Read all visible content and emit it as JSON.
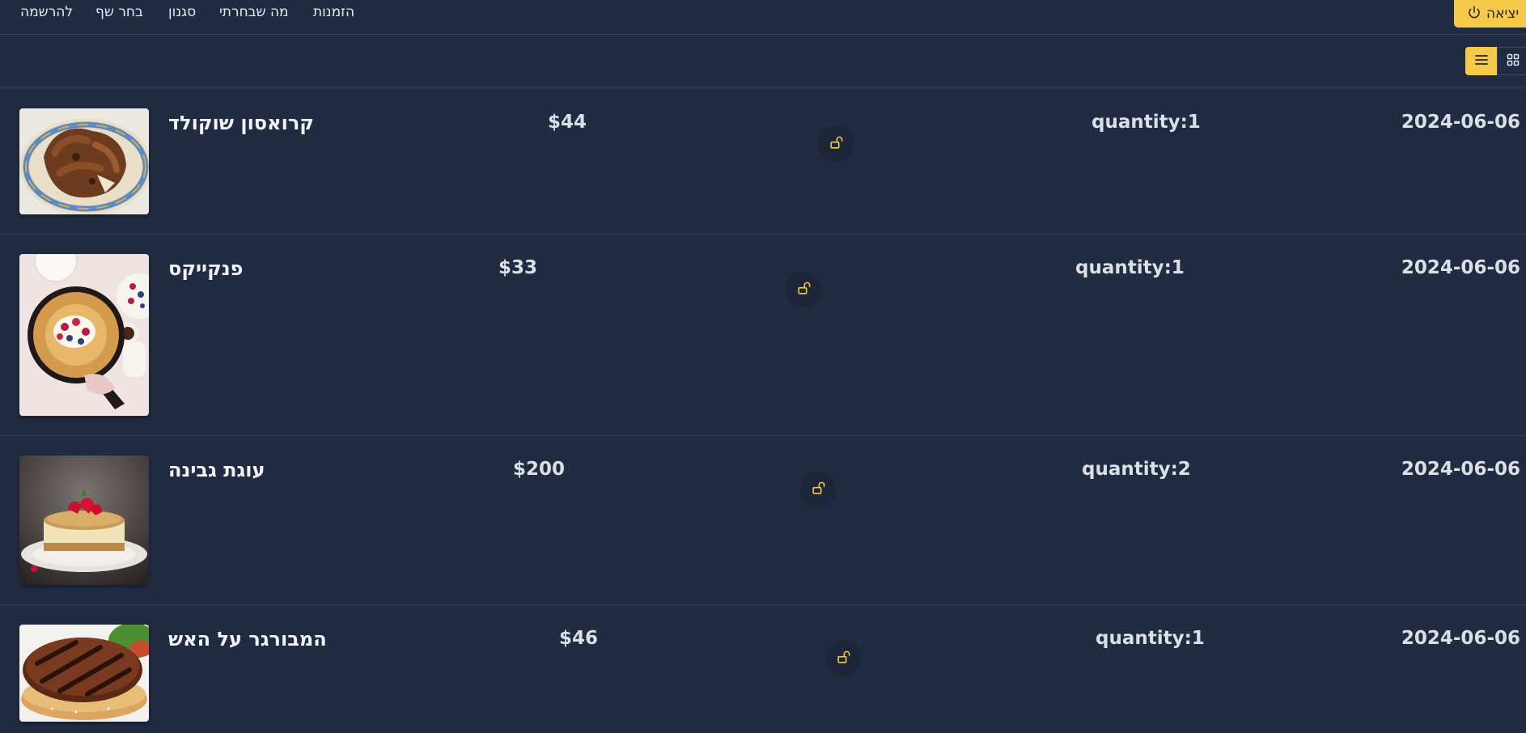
{
  "nav": {
    "links": [
      "להרשמה",
      "בחר שף",
      "סגנון",
      "מה שבחרתי",
      "הזמנות"
    ],
    "exit_label": "יציאה"
  },
  "view_toggle": {
    "active": "list"
  },
  "orders": [
    {
      "name": "קרואסון שוקולד",
      "price": "$44",
      "quantity": "quantity:1",
      "date": "2024-06-06",
      "image": "chocolate-croissant"
    },
    {
      "name": "פנקייקס",
      "price": "$33",
      "quantity": "quantity:1",
      "date": "2024-06-06",
      "image": "dutch-baby-pancake"
    },
    {
      "name": "עוגת גבינה",
      "price": "$200",
      "quantity": "quantity:2",
      "date": "2024-06-06",
      "image": "cheesecake"
    },
    {
      "name": "המבורגר על האש",
      "price": "$46",
      "quantity": "quantity:1",
      "date": "2024-06-06",
      "image": "grilled-burger"
    }
  ],
  "colors": {
    "background": "#212c42",
    "accent": "#f7c948",
    "divider": "#34405a"
  }
}
